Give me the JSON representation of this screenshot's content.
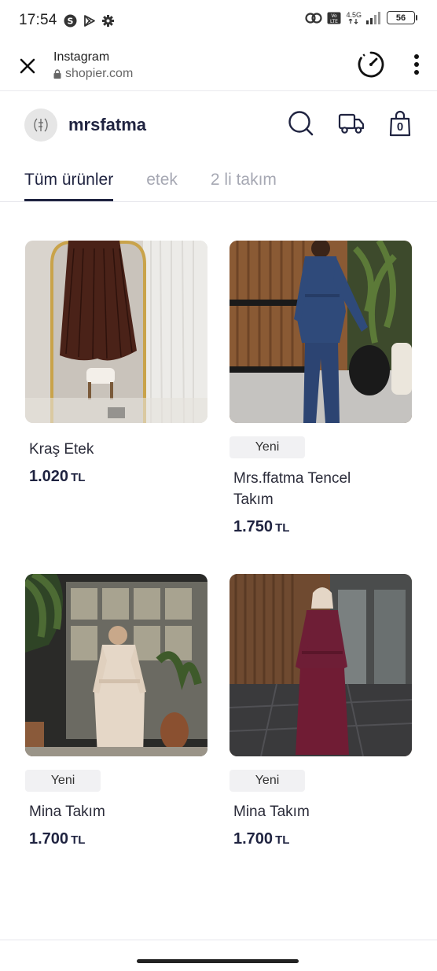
{
  "status_bar": {
    "time": "17:54",
    "net_speed_top": "4.5G",
    "battery": "56"
  },
  "browser": {
    "title": "Instagram",
    "url": "shopier.com"
  },
  "store": {
    "name": "mrsfatma",
    "cart_count": "0"
  },
  "tabs": [
    {
      "label": "Tüm ürünler",
      "active": true
    },
    {
      "label": "etek",
      "active": false
    },
    {
      "label": "2 li takım",
      "active": false
    }
  ],
  "products": [
    {
      "name": "Kraş Etek",
      "price": "1.020",
      "currency": "TL",
      "badge": ""
    },
    {
      "name": "Mrs.ffatma Tencel Takım",
      "price": "1.750",
      "currency": "TL",
      "badge": "Yeni"
    },
    {
      "name": "Mina Takım",
      "price": "1.700",
      "currency": "TL",
      "badge": "Yeni"
    },
    {
      "name": "Mina Takım",
      "price": "1.700",
      "currency": "TL",
      "badge": "Yeni"
    }
  ],
  "colors": {
    "brand_text": "#1f2340",
    "tab_inactive": "#a6a8b3",
    "badge_bg": "#f1f1f3"
  }
}
